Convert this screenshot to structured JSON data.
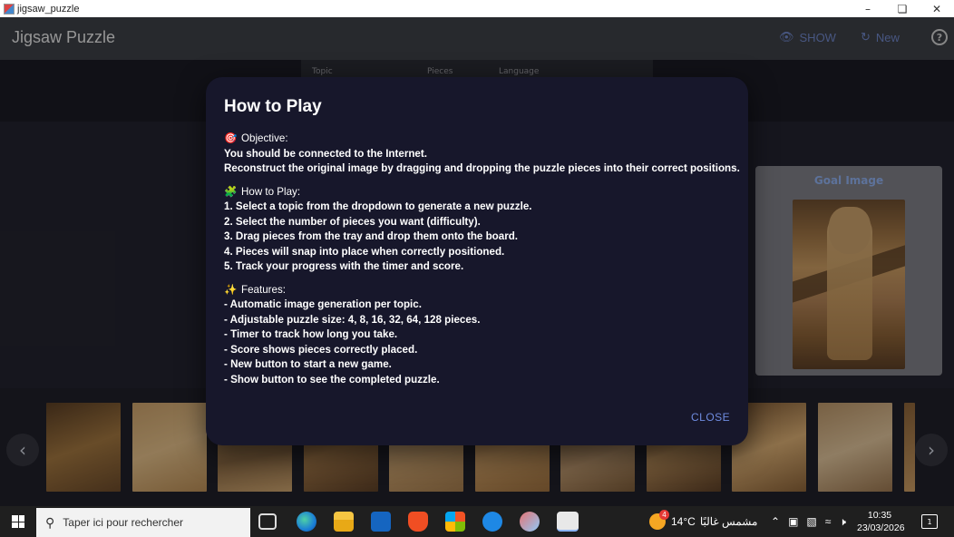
{
  "window": {
    "title": "jigsaw_puzzle"
  },
  "appbar": {
    "title": "Jigsaw Puzzle",
    "show_label": "SHOW",
    "new_label": "New",
    "help_glyph": "?"
  },
  "controls": {
    "topic_label": "Topic",
    "pieces_label": "Pieces",
    "language_label": "Language"
  },
  "goal": {
    "title": "Goal Image"
  },
  "dialog": {
    "title": "How to Play",
    "objective": {
      "heading": "Objective:",
      "lines": [
        "You should be connected to the Internet.",
        "Reconstruct the original image by dragging and dropping the puzzle pieces into their correct positions."
      ]
    },
    "howto": {
      "heading": "How to Play:",
      "lines": [
        "1. Select a topic from the dropdown to generate a new puzzle.",
        "2. Select the number of pieces you want (difficulty).",
        "3. Drag pieces from the tray and drop them onto the board.",
        "4. Pieces will snap into place when correctly positioned.",
        "5. Track your progress with the timer and score."
      ]
    },
    "features": {
      "heading": "Features:",
      "lines": [
        "- Automatic image generation per topic.",
        "- Adjustable puzzle size: 4, 8, 16, 32, 64, 128 pieces.",
        "- Timer to track how long you take.",
        "- Score shows pieces correctly placed.",
        "- New button to start a new game.",
        "- Show button to see the completed puzzle."
      ]
    },
    "close_label": "CLOSE"
  },
  "taskbar": {
    "search_placeholder": "Taper ici pour rechercher",
    "weather_temp": "14°C",
    "weather_text": "مشمس غالبًا",
    "weather_badge": "4",
    "time": "10:35",
    "date": "23/03/2026",
    "notification_count": "1"
  },
  "icons": {
    "objective": "target-icon",
    "howto": "puzzle-piece-icon",
    "features": "sparkles-icon"
  }
}
